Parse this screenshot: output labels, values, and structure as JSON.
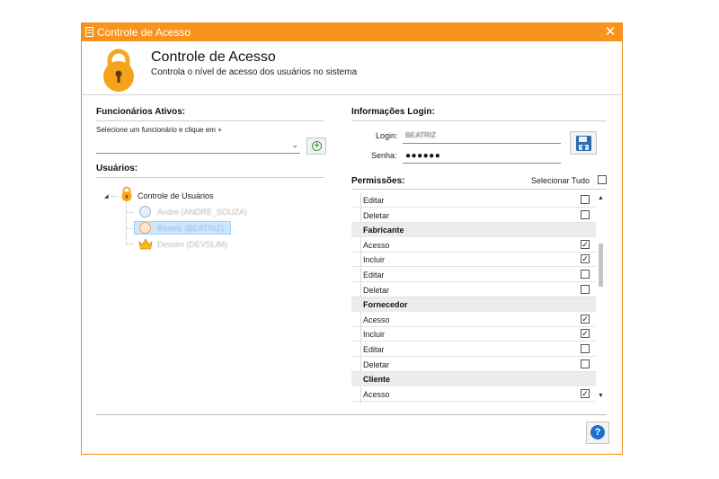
{
  "window": {
    "title": "Controle de Acesso",
    "close_glyph": "✕",
    "accent_color": "#f7941d"
  },
  "header": {
    "icon": "padlock-icon",
    "title": "Controle de Acesso",
    "subtitle": "Controla o nível de acesso dos usuários no sistema"
  },
  "funcionarios": {
    "title": "Funcionários Ativos:",
    "hint": "Selecione um funcionário e clique em +",
    "combo_value": "",
    "combo_arrow": "⌄",
    "add_button_glyph": "+"
  },
  "usuarios": {
    "title": "Usuários:",
    "root_label": "Controle de Usuários",
    "expander_glyph": "◢",
    "users": [
      {
        "label": "Andre (ANDRE_SOUZA)",
        "icon": "user-icon",
        "selected": false
      },
      {
        "label": "Beatriz (BEATRIZ)",
        "icon": "user-female-icon",
        "selected": true
      },
      {
        "label": "Devsim (DEVSLIM)",
        "icon": "crown-icon",
        "selected": false
      }
    ]
  },
  "login": {
    "title": "Informações Login:",
    "login_label": "Login:",
    "login_value": "BEATRIZ",
    "senha_label": "Senha:",
    "senha_value": "●●●●●●",
    "save_icon": "save-icon"
  },
  "permissoes": {
    "title": "Permissões:",
    "select_all_label": "Selecionar Tudo",
    "select_all_checked": false,
    "check_glyph": "✓",
    "rows": [
      {
        "type": "item",
        "label": "Editar",
        "checked": false
      },
      {
        "type": "item",
        "label": "Deletar",
        "checked": false
      },
      {
        "type": "group",
        "label": "Fabricante"
      },
      {
        "type": "item",
        "label": "Acesso",
        "checked": true
      },
      {
        "type": "item",
        "label": "Incluir",
        "checked": true
      },
      {
        "type": "item",
        "label": "Editar",
        "checked": false
      },
      {
        "type": "item",
        "label": "Deletar",
        "checked": false
      },
      {
        "type": "group",
        "label": "Fornecedor"
      },
      {
        "type": "item",
        "label": "Acesso",
        "checked": true
      },
      {
        "type": "item",
        "label": "Incluir",
        "checked": true
      },
      {
        "type": "item",
        "label": "Editar",
        "checked": false
      },
      {
        "type": "item",
        "label": "Deletar",
        "checked": false
      },
      {
        "type": "group",
        "label": "Cliente"
      },
      {
        "type": "item",
        "label": "Acesso",
        "checked": true
      }
    ],
    "scroll_up_glyph": "▲",
    "scroll_down_glyph": "▼"
  },
  "footer": {
    "help_glyph": "?",
    "help_color": "#1d6fcf"
  }
}
